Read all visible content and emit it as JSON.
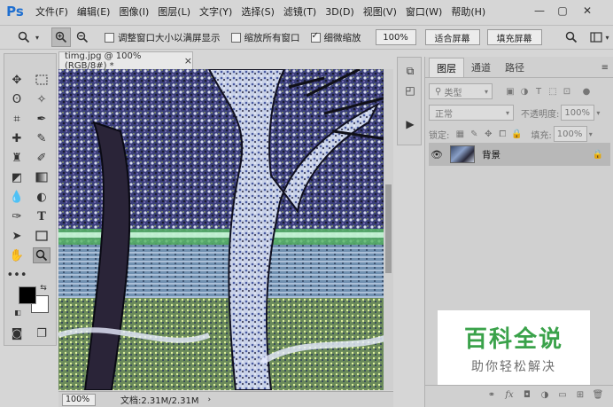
{
  "app": {
    "logo": "Ps"
  },
  "menu": [
    "文件(F)",
    "编辑(E)",
    "图像(I)",
    "图层(L)",
    "文字(Y)",
    "选择(S)",
    "滤镜(T)",
    "3D(D)",
    "视图(V)",
    "窗口(W)",
    "帮助(H)"
  ],
  "window_controls": {
    "minimize": "—",
    "restore": "▢",
    "close": "✕"
  },
  "options": {
    "resize_windows": "调整窗口大小以满屏显示",
    "zoom_all": "缩放所有窗口",
    "scrubby_zoom": "细微缩放",
    "zoom_value": "100%",
    "fit_screen": "适合屏幕",
    "fill_screen": "填充屏幕",
    "resize_checked": false,
    "zoom_all_checked": false,
    "scrubby_checked": true
  },
  "document": {
    "tab_title": "timg.jpg @ 100%(RGB/8#) *",
    "close": "×",
    "status_zoom": "100%",
    "status_doc": "文档:2.31M/2.31M"
  },
  "layers_panel": {
    "tabs": [
      "图层",
      "通道",
      "路径"
    ],
    "filter_kind": "类型",
    "blend_mode": "正常",
    "opacity_label": "不透明度:",
    "opacity_value": "100%",
    "lock_label": "锁定:",
    "fill_label": "填充:",
    "fill_value": "100%",
    "layer_name": "背景"
  },
  "watermark": {
    "title": "百科全说",
    "subtitle": "助你轻松解决"
  },
  "colors": {
    "foreground": "#000000",
    "background": "#ffffff",
    "watermark_green": "#3aa24a",
    "ps_blue": "#1f6fd0"
  },
  "icons": {
    "move": "move-icon",
    "marquee": "marquee-icon",
    "lasso": "lasso-icon",
    "magic": "magic-wand-icon",
    "crop": "crop-icon",
    "eyedropper": "eyedropper-icon",
    "healing": "healing-icon",
    "brush": "brush-icon",
    "stamp": "stamp-icon",
    "history": "history-brush-icon",
    "eraser": "eraser-icon",
    "gradient": "gradient-icon",
    "blur": "blur-icon",
    "dodge": "dodge-icon",
    "pen": "pen-icon",
    "type": "type-icon",
    "path_select": "path-select-icon",
    "shape": "rectangle-icon",
    "hand": "hand-icon",
    "zoom": "zoom-icon"
  }
}
